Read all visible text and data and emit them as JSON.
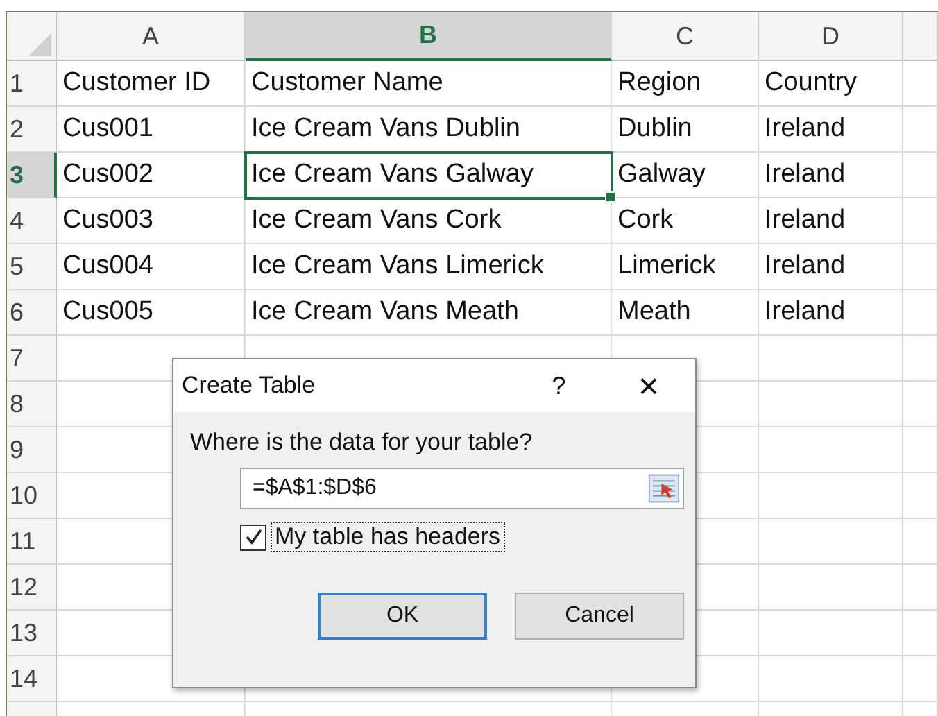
{
  "sheet": {
    "columns": [
      {
        "label": "A",
        "selected": false
      },
      {
        "label": "B",
        "selected": true
      },
      {
        "label": "C",
        "selected": false
      },
      {
        "label": "D",
        "selected": false
      }
    ],
    "rows": [
      {
        "number": "1",
        "selected": false,
        "cells": [
          "Customer ID",
          "Customer Name",
          "Region",
          "Country"
        ]
      },
      {
        "number": "2",
        "selected": false,
        "cells": [
          "Cus001",
          "Ice Cream Vans Dublin",
          "Dublin",
          "Ireland"
        ]
      },
      {
        "number": "3",
        "selected": true,
        "cells": [
          "Cus002",
          "Ice Cream Vans Galway",
          "Galway",
          "Ireland"
        ]
      },
      {
        "number": "4",
        "selected": false,
        "cells": [
          "Cus003",
          "Ice Cream Vans Cork",
          "Cork",
          "Ireland"
        ]
      },
      {
        "number": "5",
        "selected": false,
        "cells": [
          "Cus004",
          "Ice Cream Vans Limerick",
          "Limerick",
          "Ireland"
        ]
      },
      {
        "number": "6",
        "selected": false,
        "cells": [
          "Cus005",
          "Ice Cream Vans Meath",
          "Meath",
          "Ireland"
        ]
      },
      {
        "number": "7",
        "selected": false,
        "cells": []
      },
      {
        "number": "8",
        "selected": false,
        "cells": []
      },
      {
        "number": "9",
        "selected": false,
        "cells": []
      },
      {
        "number": "10",
        "selected": false,
        "cells": []
      },
      {
        "number": "11",
        "selected": false,
        "cells": []
      },
      {
        "number": "12",
        "selected": false,
        "cells": []
      },
      {
        "number": "13",
        "selected": false,
        "cells": []
      },
      {
        "number": "14",
        "selected": false,
        "cells": []
      }
    ]
  },
  "dialog": {
    "title": "Create Table",
    "help": "?",
    "close": "×",
    "prompt": "Where is the data for your table?",
    "range": "=$A$1:$D$6",
    "headers_checkbox": {
      "label": "My table has headers",
      "checked": true
    },
    "buttons": [
      {
        "label": "OK",
        "selected": true
      },
      {
        "label": "Cancel",
        "selected": false
      }
    ]
  }
}
